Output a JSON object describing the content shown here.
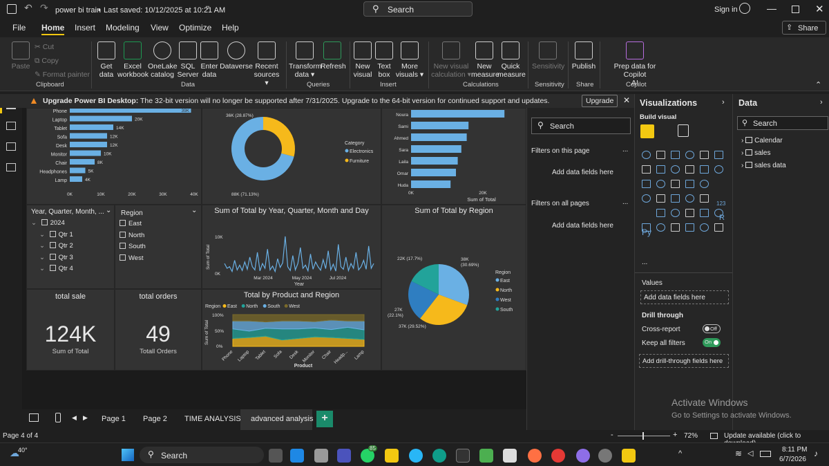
{
  "window": {
    "title": "power bi train",
    "saved": "Last saved: 10/12/2025 at 10:21 AM",
    "search": "Search",
    "sign_in": "Sign in",
    "share": "Share"
  },
  "menu": {
    "items": [
      "File",
      "Home",
      "Insert",
      "Modeling",
      "View",
      "Optimize",
      "Help"
    ]
  },
  "ribbon": {
    "clipboard": {
      "paste": "Paste",
      "cut": "Cut",
      "copy": "Copy",
      "format_painter": "Format painter",
      "group": "Clipboard"
    },
    "data": {
      "get_data": "Get",
      "get_data2": "data",
      "excel": "Excel",
      "excel2": "workbook",
      "onelake": "OneLake",
      "onelake2": "catalog",
      "sql": "SQL",
      "sql2": "Server",
      "enter": "Enter",
      "enter2": "data",
      "dataverse": "Dataverse",
      "recent": "Recent",
      "recent2": "sources",
      "group": "Data"
    },
    "queries": {
      "transform": "Transform",
      "transform2": "data",
      "refresh": "Refresh",
      "group": "Queries"
    },
    "insert": {
      "new_visual": "New",
      "new_visual2": "visual",
      "text_box": "Text",
      "text_box2": "box",
      "more": "More",
      "more2": "visuals",
      "group": "Insert"
    },
    "calculations": {
      "new_visual_calc": "New visual",
      "new_visual_calc2": "calculation",
      "new_measure": "New",
      "new_measure2": "measure",
      "quick_measure": "Quick",
      "quick_measure2": "measure",
      "group": "Calculations"
    },
    "sensitivity": {
      "label": "Sensitivity",
      "group": "Sensitivity"
    },
    "share": {
      "publish": "Publish",
      "group": "Share"
    },
    "copilot": {
      "prep": "Prep data for Copilot",
      "prep2": "AI",
      "group": "Copilot"
    }
  },
  "banner": {
    "bold": "Upgrade Power BI Desktop:",
    "text": " The 32-bit version will no longer be supported after 7/31/2025. Upgrade to the 64-bit version for continued support and updates.",
    "button": "Upgrade"
  },
  "visuals": {
    "product_bar": {
      "chart_data": {
        "type": "bar",
        "categories": [
          "Phone",
          "Laptop",
          "Tablet",
          "Sofa",
          "Desk",
          "Monitor",
          "Chair",
          "Headphones",
          "Lamp"
        ],
        "values": [
          39,
          20,
          14,
          12,
          12,
          10,
          8,
          5,
          4
        ],
        "value_labels": [
          "39K",
          "20K",
          "14K",
          "12K",
          "12K",
          "10K",
          "8K",
          "5K",
          "4K"
        ],
        "x_ticks": [
          "0K",
          "10K",
          "20K",
          "30K",
          "40K"
        ],
        "xlim": [
          0,
          40
        ]
      }
    },
    "donut": {
      "chart_data": {
        "type": "pie",
        "categories": [
          "Electronics",
          "Furniture"
        ],
        "values": [
          88,
          36
        ],
        "labels": [
          "88K (71.13%)",
          "36K (28.87%)"
        ],
        "legend_title": "Category",
        "colors": [
          "#6ab0e4",
          "#f6b91b"
        ]
      }
    },
    "customer_bar": {
      "chart_data": {
        "type": "bar",
        "categories": [
          "Noura",
          "Sami",
          "Ahmed",
          "Sara",
          "Laila",
          "Omar",
          "Huda"
        ],
        "values": [
          26,
          16,
          15.5,
          14,
          13,
          12.5,
          11
        ],
        "x_ticks": [
          "0K",
          "20K"
        ],
        "xlabel": "Sum of Total"
      }
    },
    "slicer_date": {
      "header": "Year, Quarter, Month, ...",
      "items": [
        "2024",
        "Qtr 1",
        "Qtr 2",
        "Qtr 3",
        "Qtr 4"
      ]
    },
    "slicer_region": {
      "header": "Region",
      "items": [
        "East",
        "North",
        "South",
        "West"
      ]
    },
    "line_chart": {
      "chart_data": {
        "type": "line",
        "title": "Sum of Total by Year, Quarter, Month and Day",
        "xlabel": "Year",
        "ylabel": "Sum of Total",
        "y_ticks": [
          "10K",
          "0K"
        ],
        "x_ticks": [
          "Mar 2024",
          "May 2024",
          "Jul 2024"
        ],
        "ylim": [
          0,
          13
        ],
        "values": [
          3,
          1.5,
          2,
          0.5,
          4,
          1,
          2.5,
          0.8,
          3.5,
          1.2,
          5,
          2,
          1,
          6.5,
          0.7,
          3,
          1.5,
          7.5,
          1,
          2.2,
          0.5,
          4.5,
          1.8,
          3.2,
          11.5,
          2,
          0.8,
          5.5,
          1,
          3,
          8,
          1.5,
          2.5,
          0.7,
          6,
          1.2,
          3.5,
          2,
          0.9,
          4.2,
          1.4,
          7,
          1,
          2.8,
          0.6,
          9,
          2,
          1.2,
          5,
          0.8,
          3,
          1.5,
          6.5,
          1,
          2,
          4,
          1.2,
          8.5,
          1.5,
          3
        ]
      }
    },
    "region_pie": {
      "chart_data": {
        "type": "pie",
        "title": "Sum of Total by Region",
        "legend_title": "Region",
        "categories": [
          "East",
          "North",
          "West",
          "South"
        ],
        "values": [
          38,
          37,
          27,
          22
        ],
        "labels": [
          "38K (30.69%)",
          "37K (29.52%)",
          "27K (22.1%)",
          "22K (17.7%)"
        ],
        "colors": [
          "#6ab0e4",
          "#f6b91b",
          "#2f7ec1",
          "#22a39a"
        ]
      }
    },
    "card_sale": {
      "title": "total sale",
      "value": "124K",
      "caption": "Sum of Total"
    },
    "card_orders": {
      "title": "total orders",
      "value": "49",
      "caption": "Totall Orders"
    },
    "area_chart": {
      "chart_data": {
        "type": "area",
        "title": "Total by Product and Region",
        "legend_title": "Region",
        "categories": [
          "Phone",
          "Laptop",
          "Tablet",
          "Sofa",
          "Desk",
          "Monitor",
          "Chair",
          "Headp...",
          "Lamp"
        ],
        "series": [
          {
            "name": "East",
            "values": [
              25,
              28,
              32,
              20,
              25,
              30,
              28,
              25,
              22
            ]
          },
          {
            "name": "North",
            "values": [
              30,
              20,
              25,
              35,
              30,
              28,
              25,
              35,
              30
            ]
          },
          {
            "name": "South",
            "values": [
              25,
              32,
              20,
              25,
              25,
              20,
              30,
              20,
              28
            ]
          },
          {
            "name": "West",
            "values": [
              20,
              20,
              23,
              20,
              20,
              22,
              17,
              20,
              20
            ]
          }
        ],
        "y_ticks": [
          "100%",
          "50%",
          "0%"
        ],
        "xlabel": "Product",
        "ylabel": "Sum of Total",
        "colors": [
          "#f6b91b",
          "#22a39a",
          "#6ab0e4",
          "#7a6a2a"
        ]
      }
    }
  },
  "filters": {
    "search": "Search",
    "on_page": "Filters on this page",
    "on_all": "Filters on all pages",
    "add_here": "Add data fields here",
    "more": "..."
  },
  "viz_pane": {
    "title": "Visualizations",
    "build": "Build visual",
    "values": "Values",
    "add_data": "Add data fields here",
    "drill": "Drill through",
    "cross_report": "Cross-report",
    "off": "Off",
    "keep_filters": "Keep all filters",
    "on": "On",
    "add_drill": "Add drill-through fields here",
    "more": "...",
    "py": "Py",
    "r": "R",
    "card_num": "123"
  },
  "data_pane": {
    "title": "Data",
    "search": "Search",
    "tables": [
      "Calendar",
      "sales",
      "sales data"
    ]
  },
  "pages": {
    "tabs": [
      "Page 1",
      "Page 2",
      "TIME ANALYSIS",
      "advanced analysis"
    ],
    "active": 3,
    "add": "+"
  },
  "status": {
    "page": "Page 4 of 4",
    "zoom": "72%",
    "update": "Update available (click to download)"
  },
  "watermark": {
    "line1": "Activate Windows",
    "line2": "Go to Settings to activate Windows."
  },
  "taskbar": {
    "search": "Search",
    "weather": "40°",
    "time": "8:11 PM",
    "date": "6/7/2026",
    "badge": "85"
  }
}
